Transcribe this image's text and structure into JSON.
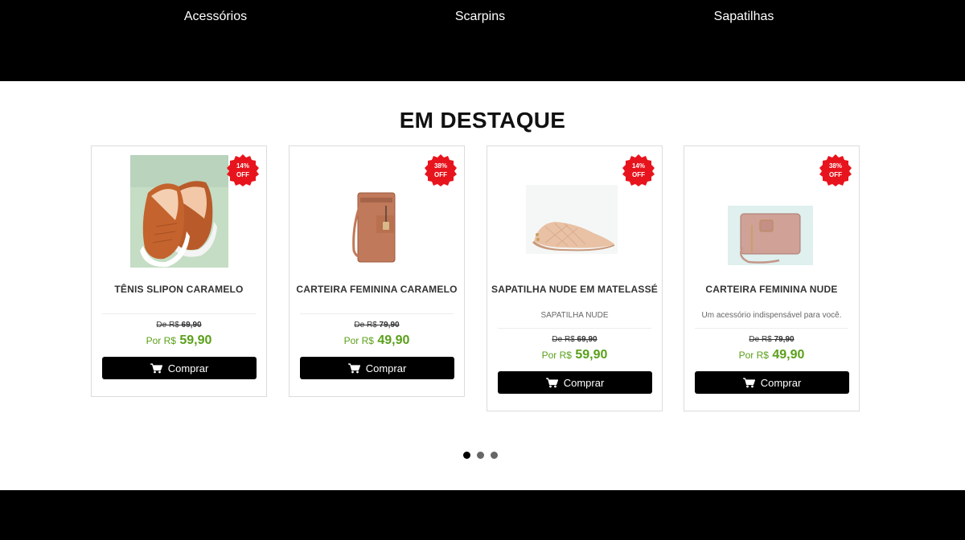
{
  "nav": {
    "items": [
      {
        "label": "Acessórios"
      },
      {
        "label": "Scarpins"
      },
      {
        "label": "Sapatilhas"
      }
    ]
  },
  "section": {
    "title": "EM DESTAQUE"
  },
  "products": [
    {
      "name": "TÊNIS SLIPON CARAMELO",
      "description": "",
      "discount": "14%\nOFF",
      "old_price_prefix": "De R$",
      "old_price": "69,90",
      "new_price_prefix": "Por R$",
      "new_price": "59,90",
      "buy_label": "Comprar"
    },
    {
      "name": "CARTEIRA FEMININA CARAMELO",
      "description": "",
      "discount": "38%\nOFF",
      "old_price_prefix": "De R$",
      "old_price": "79,90",
      "new_price_prefix": "Por R$",
      "new_price": "49,90",
      "buy_label": "Comprar"
    },
    {
      "name": "SAPATILHA NUDE EM MATELASSÉ",
      "description": "SAPATILHA NUDE",
      "discount": "14%\nOFF",
      "old_price_prefix": "De R$",
      "old_price": "69,90",
      "new_price_prefix": "Por R$",
      "new_price": "59,90",
      "buy_label": "Comprar"
    },
    {
      "name": "CARTEIRA FEMININA NUDE",
      "description": "Um acessório indispensável para você.",
      "discount": "38%\nOFF",
      "old_price_prefix": "De R$",
      "old_price": "79,90",
      "new_price_prefix": "Por R$",
      "new_price": "49,90",
      "buy_label": "Comprar"
    }
  ],
  "carousel": {
    "dots": 3,
    "active_index": 0
  },
  "colors": {
    "nav_bg": "#000000",
    "price_green": "#5aa01a",
    "badge_red": "#e8141d",
    "button_bg": "#000000"
  },
  "icons": {
    "badge": "starburst-badge-icon",
    "cart": "shopping-cart-icon"
  }
}
